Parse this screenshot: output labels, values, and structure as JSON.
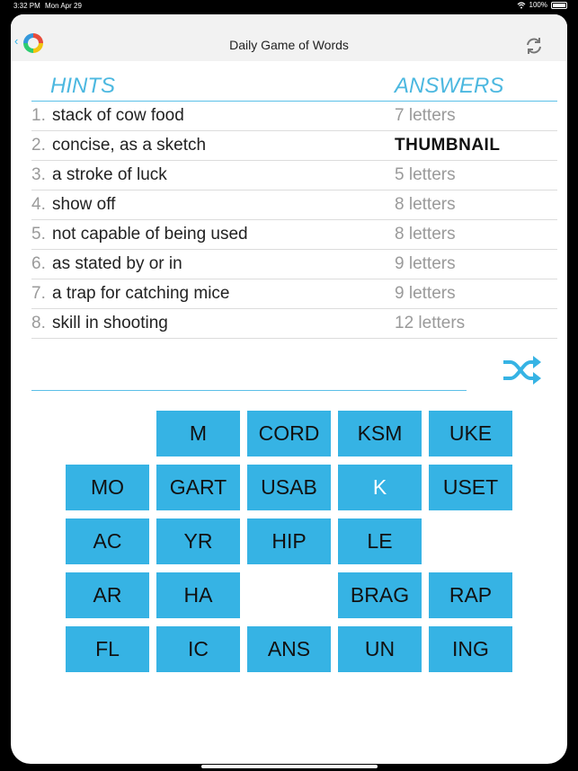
{
  "status": {
    "time": "3:32 PM",
    "date": "Mon Apr 29",
    "battery": "100%"
  },
  "header": {
    "title": "Daily Game of Words",
    "back_icon": "back-chevron-icon",
    "logo_icon": "app-logo-icon",
    "refresh_icon": "refresh-icon"
  },
  "columns": {
    "hints": "HINTS",
    "answers": "ANSWERS"
  },
  "rows": [
    {
      "num": "1.",
      "hint": "stack of cow food",
      "answer": "7 letters"
    },
    {
      "num": "2.",
      "hint": "concise, as a sketch",
      "answer": "THUMBNAIL"
    },
    {
      "num": "3.",
      "hint": "a stroke of luck",
      "answer": "5 letters"
    },
    {
      "num": "4.",
      "hint": "show off",
      "answer": "8 letters"
    },
    {
      "num": "5.",
      "hint": "not capable of being used",
      "answer": "8 letters"
    },
    {
      "num": "6.",
      "hint": "as stated by or in",
      "answer": "9 letters"
    },
    {
      "num": "7.",
      "hint": "a trap for catching mice",
      "answer": "9 letters"
    },
    {
      "num": "8.",
      "hint": "skill in shooting",
      "answer": "12 letters"
    }
  ],
  "tiles": [
    "",
    "M",
    "CORD",
    "KSM",
    "UKE",
    "MO",
    "GART",
    "USAB",
    "K",
    "USET",
    "AC",
    "YR",
    "HIP",
    "LE",
    "",
    "AR",
    "HA",
    "",
    "BRAG",
    "RAP",
    "FL",
    "IC",
    "ANS",
    "UN",
    "ING"
  ],
  "colors": {
    "accent": "#36b3e4",
    "tile_text": "#111111",
    "tile_text_light": "#ffffff"
  }
}
